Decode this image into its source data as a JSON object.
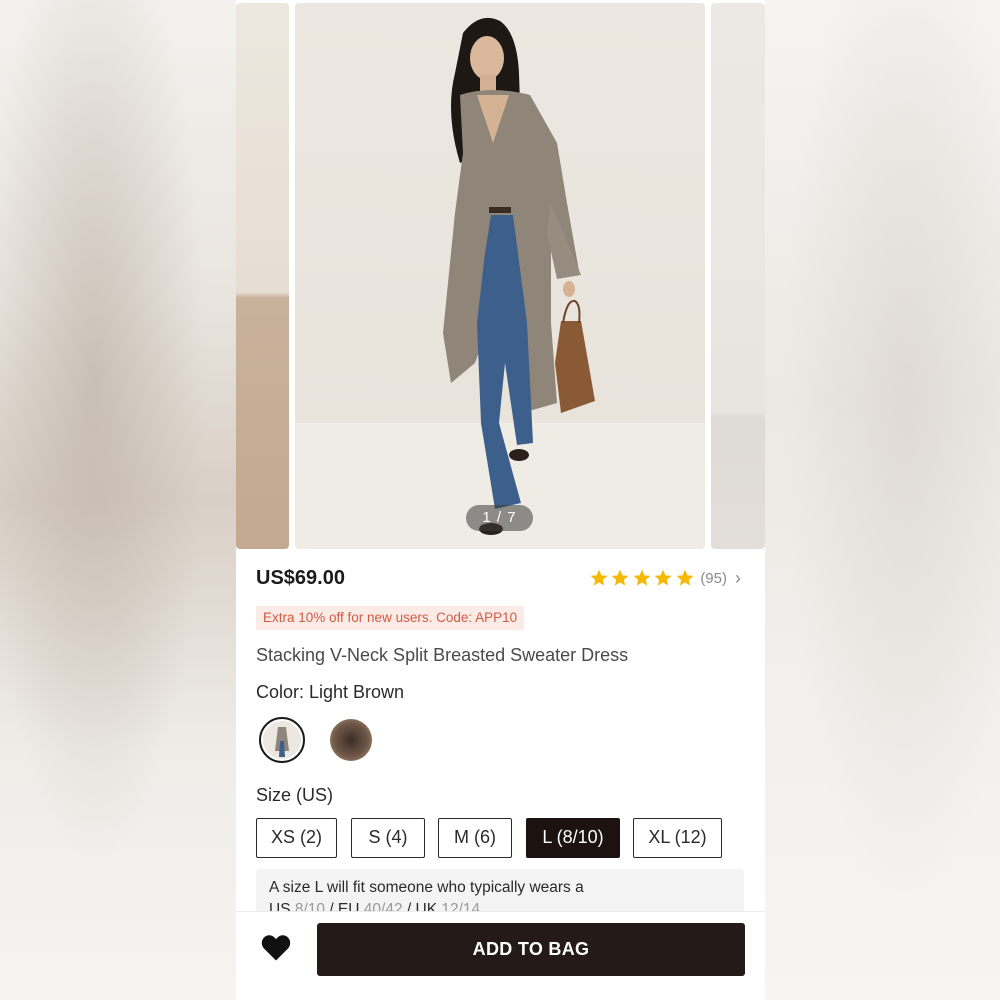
{
  "gallery": {
    "counter": "1 / 7",
    "image_alt": "Model wearing long grey-brown sweater dress with flared jeans and brown handbag"
  },
  "product": {
    "price": "US$69.00",
    "rating": 5,
    "rating_count": "(95)",
    "promo": "Extra 10% off for new users. Code: APP10",
    "title": "Stacking V-Neck Split Breasted Sweater Dress"
  },
  "color": {
    "label": "Color: Light Brown",
    "options": [
      "Light Brown",
      "Dark Brown"
    ],
    "selected": "Light Brown"
  },
  "size": {
    "label": "Size (US)",
    "options": [
      "XS (2)",
      "S (4)",
      "M (6)",
      "L (8/10)",
      "XL (12)"
    ],
    "selected": "L (8/10)",
    "fit_note_line1": "A size L will fit someone who typically wears a",
    "fit_note_line2_prefix": "US ",
    "fit_note_line2_us": "8/10",
    "fit_note_line2_eu_prefix": " / EU ",
    "fit_note_line2_eu": "40/42",
    "fit_note_line2_uk_prefix": " / UK ",
    "fit_note_line2_uk": "12/14"
  },
  "actions": {
    "add_to_bag": "ADD TO BAG"
  },
  "colors": {
    "star": "#f6b800",
    "primary_button": "#241a17",
    "promo_text": "#cf5b43",
    "promo_bg": "#fbebe7"
  }
}
